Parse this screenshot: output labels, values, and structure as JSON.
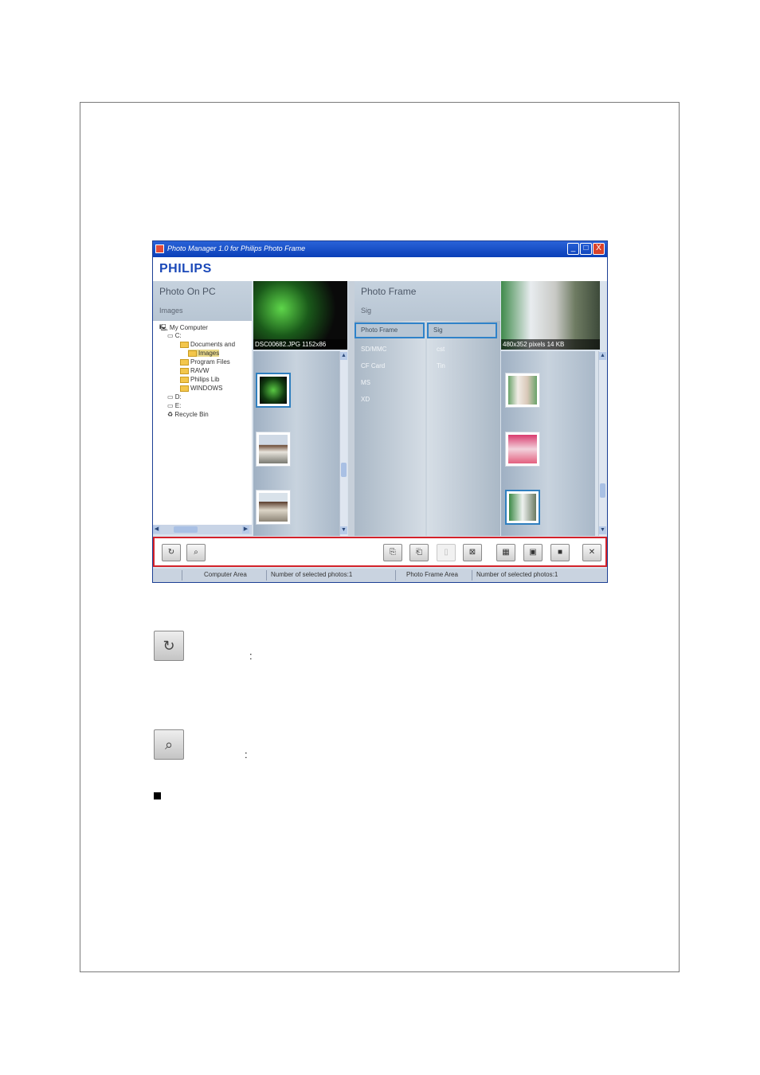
{
  "window": {
    "title": "Photo Manager 1.0 for Philips Photo Frame",
    "controls": [
      "_",
      "□",
      "X"
    ]
  },
  "brand": "PHILIPS",
  "pc_panel": {
    "title": "Photo On PC",
    "path": "Images",
    "tree": [
      {
        "label": "My Computer",
        "icon": "computer-icon"
      },
      {
        "label": "C:",
        "icon": "drive-icon"
      },
      {
        "label": "Documents and",
        "icon": "folder-icon"
      },
      {
        "label": "Images",
        "icon": "folder-icon"
      },
      {
        "label": "Program Files",
        "icon": "folder-icon"
      },
      {
        "label": "RAVW",
        "icon": "folder-icon"
      },
      {
        "label": "Philips Lib",
        "icon": "folder-icon"
      },
      {
        "label": "WINDOWS",
        "icon": "folder-icon"
      },
      {
        "label": "D:",
        "icon": "drive-icon"
      },
      {
        "label": "E:",
        "icon": "drive-icon"
      },
      {
        "label": "Recycle Bin",
        "icon": "recycle-bin-icon"
      }
    ],
    "preview_caption": "DSC00682.JPG 1152x86"
  },
  "frame_panel": {
    "title": "Photo Frame",
    "path": "Sig",
    "list": [
      {
        "name": "Photo Frame",
        "value": "Sig"
      },
      {
        "name": "SD/MMC",
        "value": "cst"
      },
      {
        "name": "CF Card",
        "value": "Tin"
      },
      {
        "name": "MS",
        "value": ""
      },
      {
        "name": "XD",
        "value": ""
      }
    ],
    "preview_caption": "480x352 pixels 14 KB"
  },
  "toolbar": {
    "buttons": [
      {
        "name": "rotate-button",
        "glyph": "↻",
        "enabled": true
      },
      {
        "name": "zoom-button",
        "glyph": "⌕",
        "enabled": true
      },
      {
        "name": "copy-to-frame-button",
        "glyph": "⎘",
        "enabled": true
      },
      {
        "name": "copy-to-pc-button",
        "glyph": "⎗",
        "enabled": true
      },
      {
        "name": "paste-button",
        "glyph": "▯",
        "enabled": false
      },
      {
        "name": "delete-button",
        "glyph": "⊠",
        "enabled": true
      },
      {
        "name": "view-small-button",
        "glyph": "▦",
        "enabled": true
      },
      {
        "name": "view-medium-button",
        "glyph": "▣",
        "enabled": true
      },
      {
        "name": "view-large-button",
        "glyph": "■",
        "enabled": true
      },
      {
        "name": "close-button",
        "glyph": "✕",
        "enabled": true
      }
    ]
  },
  "statusbar": {
    "pc_area": "Computer Area",
    "pc_count": "Number of selected photos:1",
    "frame_area": "Photo Frame Area",
    "frame_count": "Number of selected photos:1"
  },
  "doc": {
    "rotate_icon_glyph": "↻",
    "rotate_colon": ":",
    "zoom_icon_glyph": "⌕",
    "zoom_colon": ":"
  },
  "colors": {
    "title_bar": "#0a3fb8",
    "brand": "#1a48b8",
    "highlight": "#d3222a",
    "selection": "#2f82c9"
  }
}
